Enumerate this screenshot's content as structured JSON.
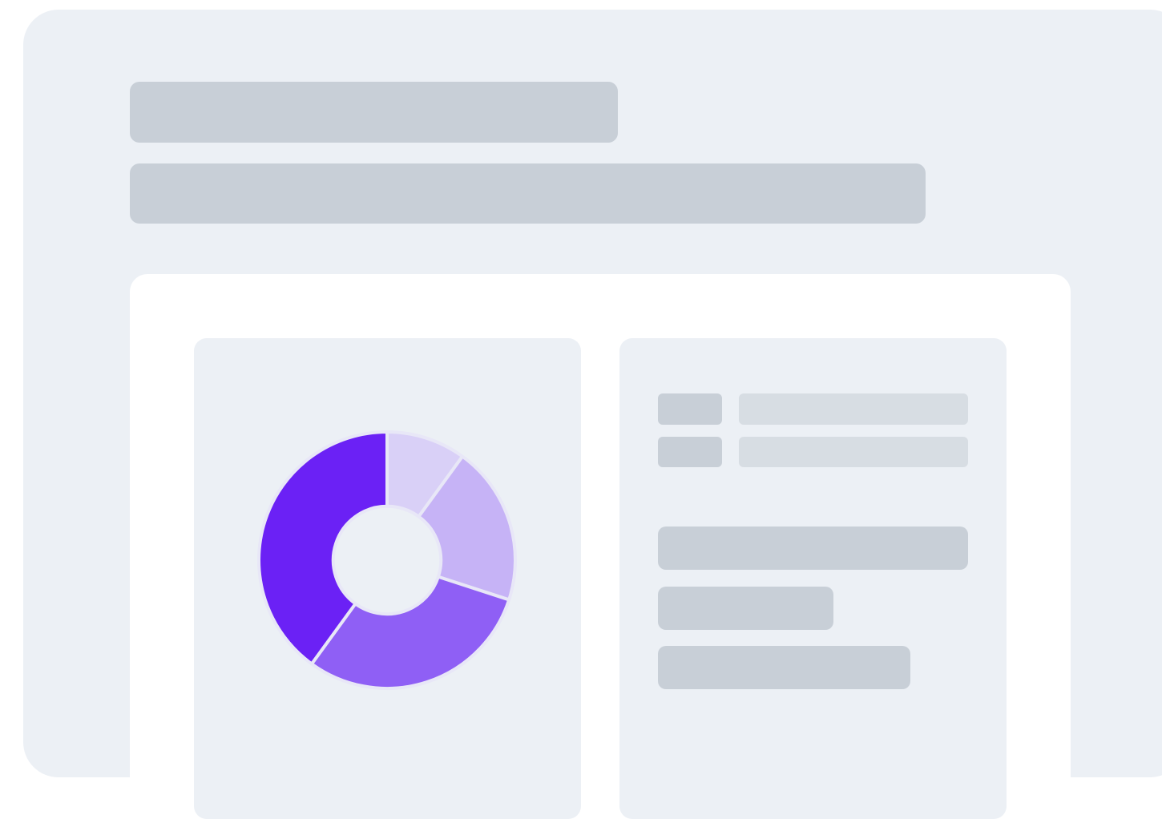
{
  "colors": {
    "frame_background": "#ecf0f5",
    "card_background": "#ffffff",
    "skeleton": "#c8cfd7",
    "skeleton_light": "#d7dde3"
  },
  "chart_data": {
    "type": "pie",
    "variant": "donut",
    "title": "",
    "slices": [
      {
        "value": 10,
        "color": "#d9d0f7"
      },
      {
        "value": 20,
        "color": "#c6b3f6"
      },
      {
        "value": 30,
        "color": "#8f5ff5"
      },
      {
        "value": 40,
        "color": "#6b21f5"
      }
    ],
    "start_angle_deg": 0,
    "direction": "clockwise",
    "inner_radius_ratio": 0.42
  },
  "details_panel": {
    "key_value_rows": 2,
    "text_lines": 3
  }
}
